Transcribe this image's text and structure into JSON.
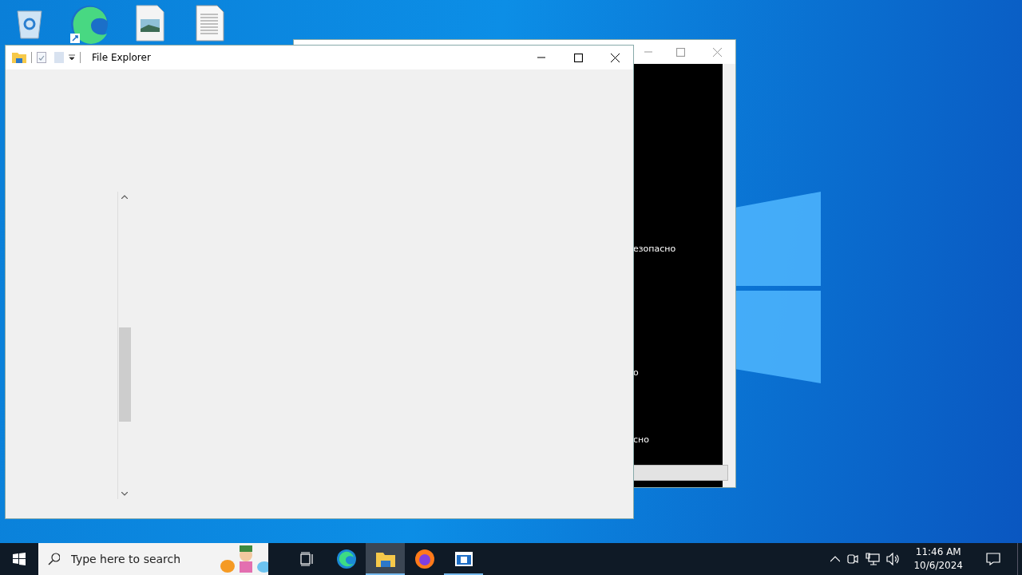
{
  "background_window": {
    "lines": [
      "езопасно",
      "о",
      "сно"
    ]
  },
  "explorer": {
    "title": "File Explorer"
  },
  "taskbar": {
    "search": {
      "placeholder": "Type here to search"
    },
    "apps": [
      {
        "kind": "task-view",
        "selected": false,
        "running": false
      },
      {
        "kind": "edge",
        "selected": false,
        "running": false
      },
      {
        "kind": "explorer",
        "selected": true,
        "running": true
      },
      {
        "kind": "firefox",
        "selected": false,
        "running": false
      },
      {
        "kind": "window",
        "selected": false,
        "running": true
      }
    ],
    "time": "11:46 AM",
    "date": "10/6/2024"
  }
}
